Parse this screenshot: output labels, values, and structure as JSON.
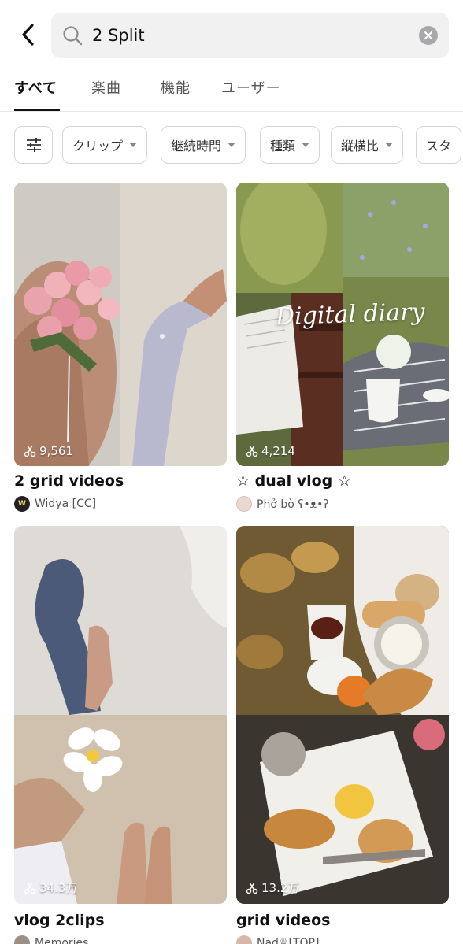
{
  "search": {
    "query": "2 Split"
  },
  "tabs": [
    {
      "label": "すべて",
      "active": true
    },
    {
      "label": "楽曲",
      "active": false
    },
    {
      "label": "機能",
      "active": false
    },
    {
      "label": "ユーザー",
      "active": false
    }
  ],
  "filters": [
    {
      "label": "クリップ"
    },
    {
      "label": "継続時間"
    },
    {
      "label": "種類"
    },
    {
      "label": "縦横比"
    },
    {
      "label": "スタ"
    }
  ],
  "cards": [
    {
      "uses": "9,561",
      "title": "2 grid videos",
      "author": "Widya [CC]"
    },
    {
      "uses": "4,214",
      "title": "☆ dual vlog ☆",
      "author": "Phở bò ʕ•ᴥ•ʔ",
      "overlay_text": "Digital diary"
    },
    {
      "uses": "34.3万",
      "title": "vlog 2clips",
      "author": "Memories"
    },
    {
      "uses": "13.2万",
      "title": "grid videos",
      "author": "Nad♕[TOP]"
    }
  ],
  "colors": {
    "accent": "#111111",
    "chip_border": "#d5d5d8",
    "search_bg": "#f1f1f2"
  }
}
